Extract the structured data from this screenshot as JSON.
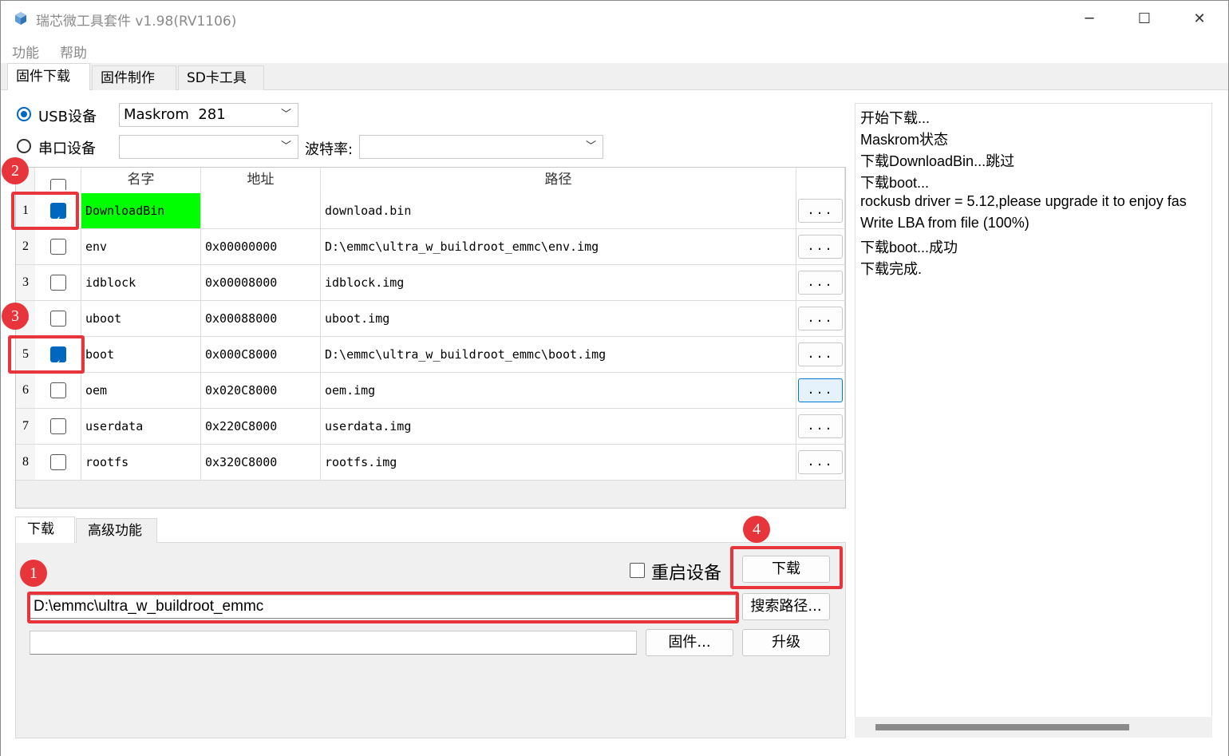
{
  "window": {
    "title": "瑞芯微工具套件 v1.98(RV1106)",
    "min_glyph": "─",
    "max_glyph": "☐",
    "close_glyph": "✕"
  },
  "menu": [
    "功能",
    "帮助"
  ],
  "tabs": [
    "固件下载",
    "固件制作",
    "SD卡工具"
  ],
  "device": {
    "usb_label": "USB设备",
    "usb_value": "Maskrom  281",
    "serial_label": "串口设备",
    "serial_value": "",
    "baud_label": "波特率:",
    "baud_value": ""
  },
  "table": {
    "headers": [
      "名字",
      "地址",
      "路径"
    ],
    "rows": [
      {
        "num": "1",
        "checked": true,
        "name": "DownloadBin",
        "addr": "",
        "path": "download.bin",
        "highlight": true
      },
      {
        "num": "2",
        "checked": false,
        "name": "env",
        "addr": "0x00000000",
        "path": "D:\\emmc\\ultra_w_buildroot_emmc\\env.img"
      },
      {
        "num": "3",
        "checked": false,
        "name": "idblock",
        "addr": "0x00008000",
        "path": "idblock.img"
      },
      {
        "num": "4",
        "checked": false,
        "name": "uboot",
        "addr": "0x00088000",
        "path": "uboot.img"
      },
      {
        "num": "5",
        "checked": true,
        "name": "boot",
        "addr": "0x000C8000",
        "path": "D:\\emmc\\ultra_w_buildroot_emmc\\boot.img"
      },
      {
        "num": "6",
        "checked": false,
        "name": "oem",
        "addr": "0x020C8000",
        "path": "oem.img"
      },
      {
        "num": "7",
        "checked": false,
        "name": "userdata",
        "addr": "0x220C8000",
        "path": "userdata.img"
      },
      {
        "num": "8",
        "checked": false,
        "name": "rootfs",
        "addr": "0x320C8000",
        "path": "rootfs.img"
      }
    ],
    "browse_label": "...",
    "highlight_color": "#00ff00"
  },
  "bottom_tabs": [
    "下载",
    "高级功能"
  ],
  "download": {
    "reboot_label": "重启设备",
    "download_button": "下载",
    "path_value": "D:\\emmc\\ultra_w_buildroot_emmc",
    "search_button": "搜索路径...",
    "firmware_value": "",
    "firmware_button": "固件...",
    "upgrade_button": "升级"
  },
  "log": [
    "开始下载...",
    "Maskrom状态",
    "下载DownloadBin...跳过",
    "下载boot...",
    "rockusb driver = 5.12,please upgrade it to enjoy fas",
    "Write LBA from file (100%)",
    "下载boot...成功",
    "下载完成."
  ],
  "annotations": {
    "color": "#e8353b",
    "labels": [
      "1",
      "2",
      "3",
      "4"
    ]
  }
}
